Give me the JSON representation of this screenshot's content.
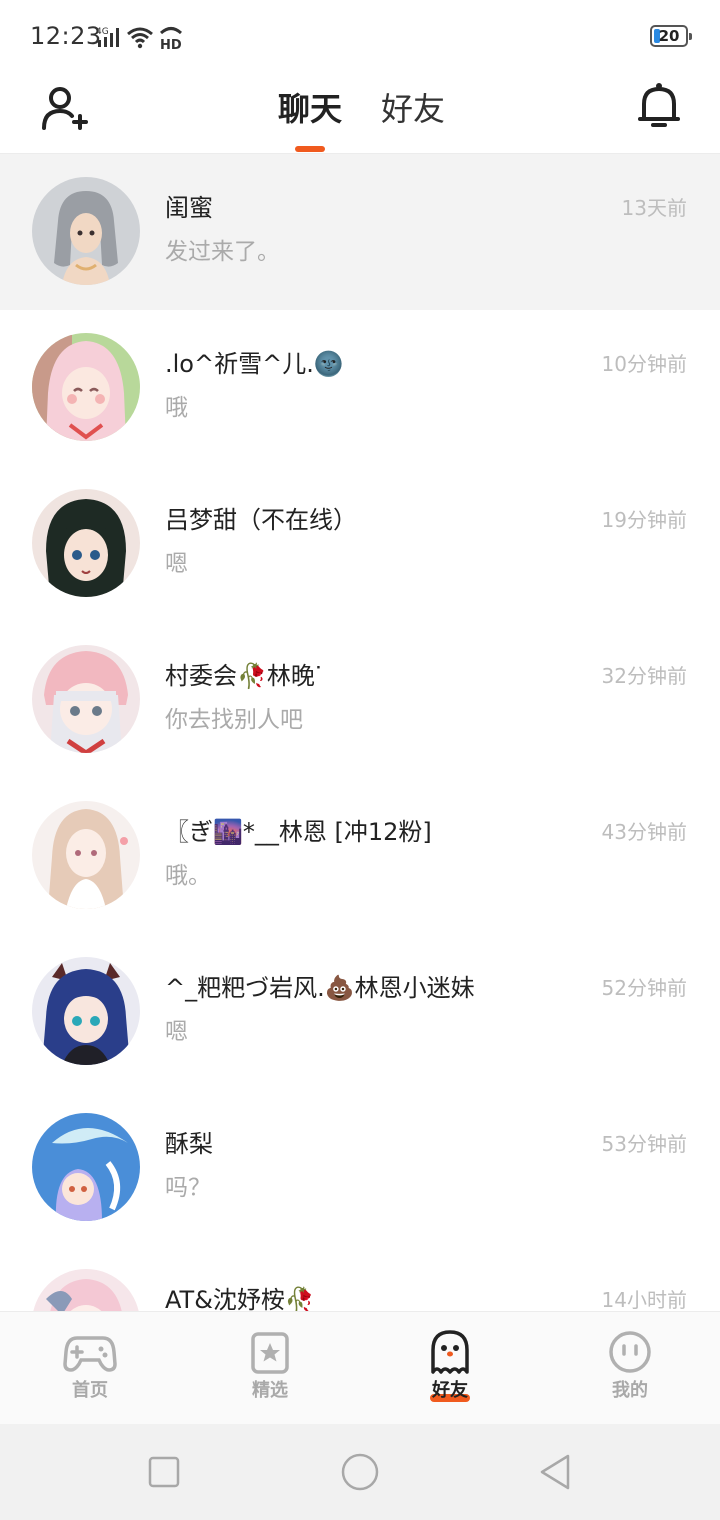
{
  "status_bar": {
    "time": "12:23",
    "battery": "20",
    "network": "4G",
    "hd": "HD"
  },
  "header": {
    "tabs": [
      {
        "label": "聊天",
        "active": true
      },
      {
        "label": "好友",
        "active": false
      }
    ],
    "accent_color": "#f05a1e"
  },
  "chats": [
    {
      "name": "闺蜜",
      "message": "发过来了。",
      "time": "13天前",
      "pinned": true
    },
    {
      "name": ".lo^祈雪^儿.🌚",
      "message": "哦",
      "time": "10分钟前"
    },
    {
      "name": "吕梦甜（不在线）",
      "message": "嗯",
      "time": "19分钟前"
    },
    {
      "name": "村委会🥀林晚ᐝ",
      "message": "你去找别人吧",
      "time": "32分钟前"
    },
    {
      "name": "〖ぎ🌆*__林恩 [冲12粉]",
      "message": "哦。",
      "time": "43分钟前"
    },
    {
      "name": "^_粑粑づ岩风.💩林恩小迷妹",
      "message": "嗯",
      "time": "52分钟前"
    },
    {
      "name": "酥梨",
      "message": "吗？",
      "time": "53分钟前"
    },
    {
      "name": "AT&沈妤桉🥀",
      "message": "",
      "time": "14小时前"
    }
  ],
  "bottom_nav": [
    {
      "label": "首页",
      "icon": "gamepad-icon",
      "active": false
    },
    {
      "label": "精选",
      "icon": "star-card-icon",
      "active": false
    },
    {
      "label": "好友",
      "icon": "ghost-icon",
      "active": true
    },
    {
      "label": "我的",
      "icon": "face-icon",
      "active": false
    }
  ]
}
